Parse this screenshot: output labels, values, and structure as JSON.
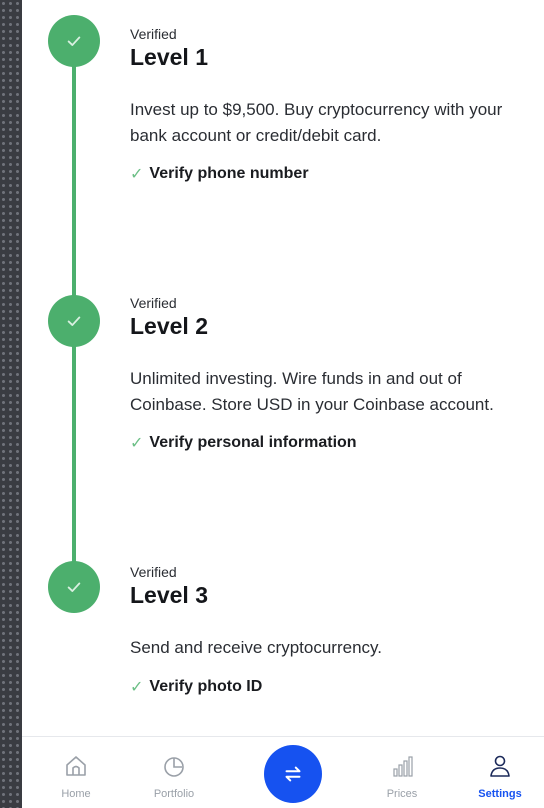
{
  "levels": [
    {
      "status": "Verified",
      "title": "Level 1",
      "description": "Invest up to $9,500. Buy cryptocurrency with your bank account or credit/debit card.",
      "requirement": "Verify phone number"
    },
    {
      "status": "Verified",
      "title": "Level 2",
      "description": "Unlimited investing. Wire funds in and out of Coinbase. Store USD in your Coinbase account.",
      "requirement": "Verify personal information"
    },
    {
      "status": "Verified",
      "title": "Level 3",
      "description": "Send and receive cryptocurrency.",
      "requirement": "Verify photo ID"
    }
  ],
  "check_glyph": "✓",
  "tabs": [
    {
      "label": "Home",
      "icon": "home-icon"
    },
    {
      "label": "Portfolio",
      "icon": "pie-chart-icon"
    },
    {
      "label": "",
      "icon": "swap-arrows-icon"
    },
    {
      "label": "Prices",
      "icon": "bar-chart-icon"
    },
    {
      "label": "Settings",
      "icon": "user-icon"
    }
  ],
  "active_tab": "Settings",
  "colors": {
    "verified_green": "#4caf6d",
    "accent_blue": "#1652f0",
    "inactive_tab": "#9aa0a8"
  }
}
